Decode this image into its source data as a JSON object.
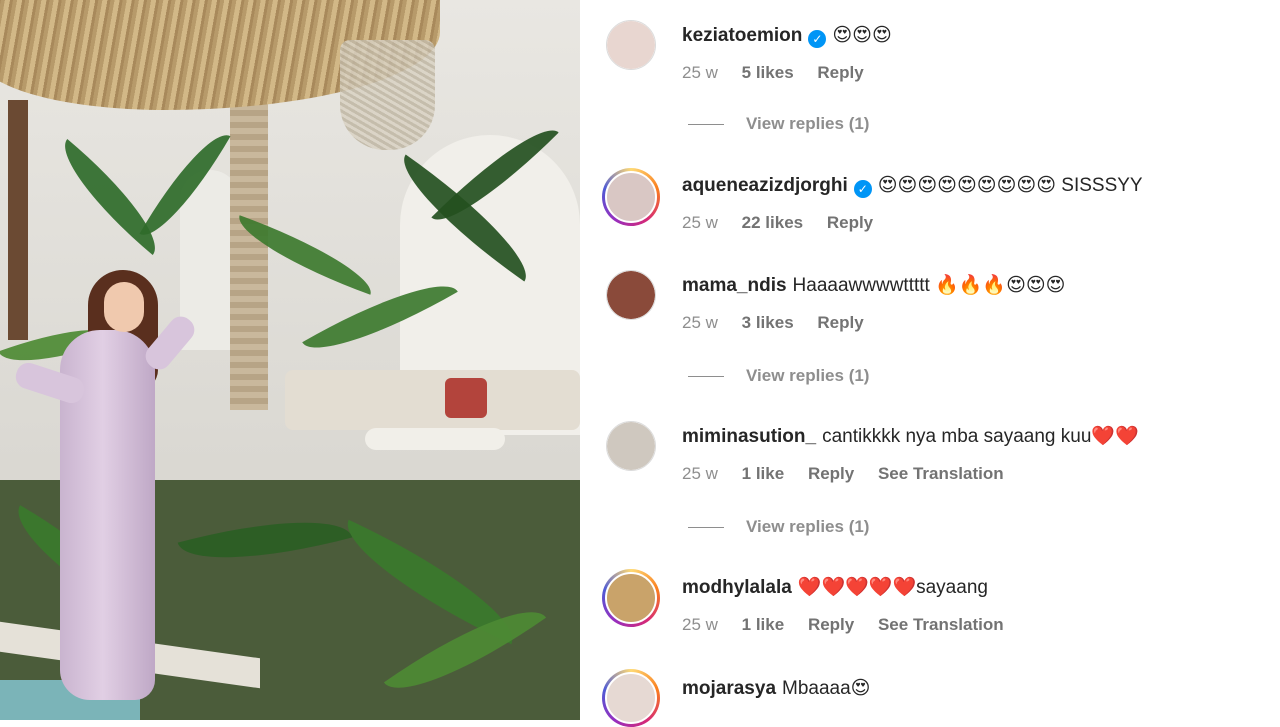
{
  "comments": [
    {
      "username": "keziatoemion",
      "verified": true,
      "text": "😍😍😍",
      "time": "25 w",
      "likes": "5 likes",
      "reply_label": "Reply",
      "avatar_color": "#e8d6d0",
      "view_replies": "View replies (1)"
    },
    {
      "username": "aqueneazizdjorghi",
      "verified": true,
      "text": "😍😍😍😍😍😍😍😍😍 SISSSYY",
      "time": "25 w",
      "likes": "22 likes",
      "reply_label": "Reply",
      "avatar_color": "#d9c7c4"
    },
    {
      "username": "mama_ndis",
      "verified": false,
      "text": "Haaaawwwwttttt 🔥🔥🔥😍😍😍",
      "time": "25 w",
      "likes": "3 likes",
      "reply_label": "Reply",
      "avatar_color": "#8a4a3a",
      "view_replies": "View replies (1)"
    },
    {
      "username": "miminasution_",
      "verified": false,
      "text": "cantikkkk nya mba sayaang kuu❤️❤️",
      "time": "25 w",
      "likes": "1 like",
      "reply_label": "Reply",
      "translation_label": "See Translation",
      "avatar_color": "#cfc8bf",
      "view_replies": "View replies (1)"
    },
    {
      "username": "modhylalala",
      "verified": false,
      "text": "❤️❤️❤️❤️❤️sayaang",
      "time": "25 w",
      "likes": "1 like",
      "reply_label": "Reply",
      "translation_label": "See Translation",
      "avatar_color": "#c9a36a"
    },
    {
      "username": "mojarasya",
      "verified": false,
      "text": "Mbaaaa😍",
      "avatar_color": "#e6d9d3"
    }
  ],
  "icons": {
    "verified": "verified-badge-icon"
  },
  "colors": {
    "accent": "#0095f6",
    "muted": "#8e8e8e"
  }
}
